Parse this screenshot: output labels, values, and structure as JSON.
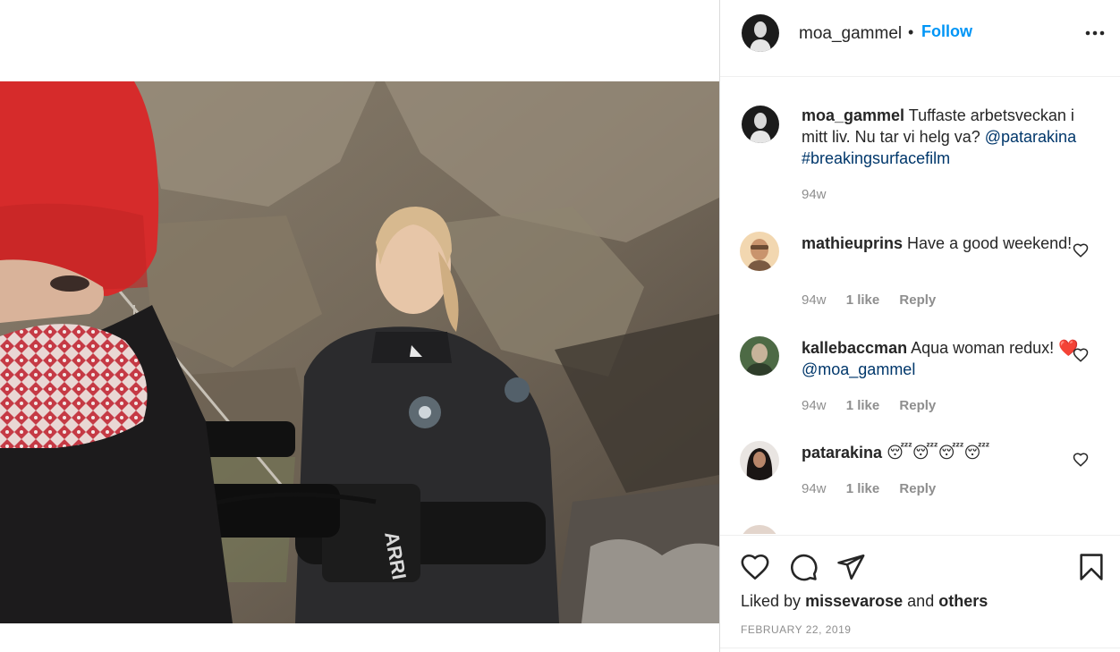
{
  "post": {
    "author": "moa_gammel",
    "dot": "•",
    "follow_label": "Follow",
    "more_icon": "more-horizontal-icon",
    "image_alt": "Photo of a woman in a drysuit beside a rocky cliff, a person in a red knit hat and mitten holding an ARRI camera in the foreground",
    "camera_text": "ARRI"
  },
  "caption": {
    "username": "moa_gammel",
    "text": "Tuffaste arbetsveckan i mitt liv. Nu tar vi helg va?",
    "mention": "@patarakina",
    "hashtag": "#breakingsurfacefilm",
    "age": "94w"
  },
  "comments": [
    {
      "username": "mathieuprins",
      "text": "Have a good weekend!",
      "age": "94w",
      "likes": "1 like",
      "reply": "Reply"
    },
    {
      "username": "kallebaccman",
      "text": "Aqua woman redux!",
      "emoji": "❤️",
      "mention": "@moa_gammel",
      "age": "94w",
      "likes": "1 like",
      "reply": "Reply"
    },
    {
      "username": "patarakina",
      "text": "😴😴😴😴",
      "age": "94w",
      "likes": "1 like",
      "reply": "Reply"
    }
  ],
  "footer": {
    "liked_prefix": "Liked by",
    "liked_user": "missevarose",
    "liked_and": "and",
    "liked_others": "others",
    "date": "FEBRUARY 22, 2019"
  },
  "colors": {
    "follow": "#0095f6",
    "link": "#00376b",
    "muted": "#8e8e8e",
    "heart_red": "#ed4956"
  }
}
